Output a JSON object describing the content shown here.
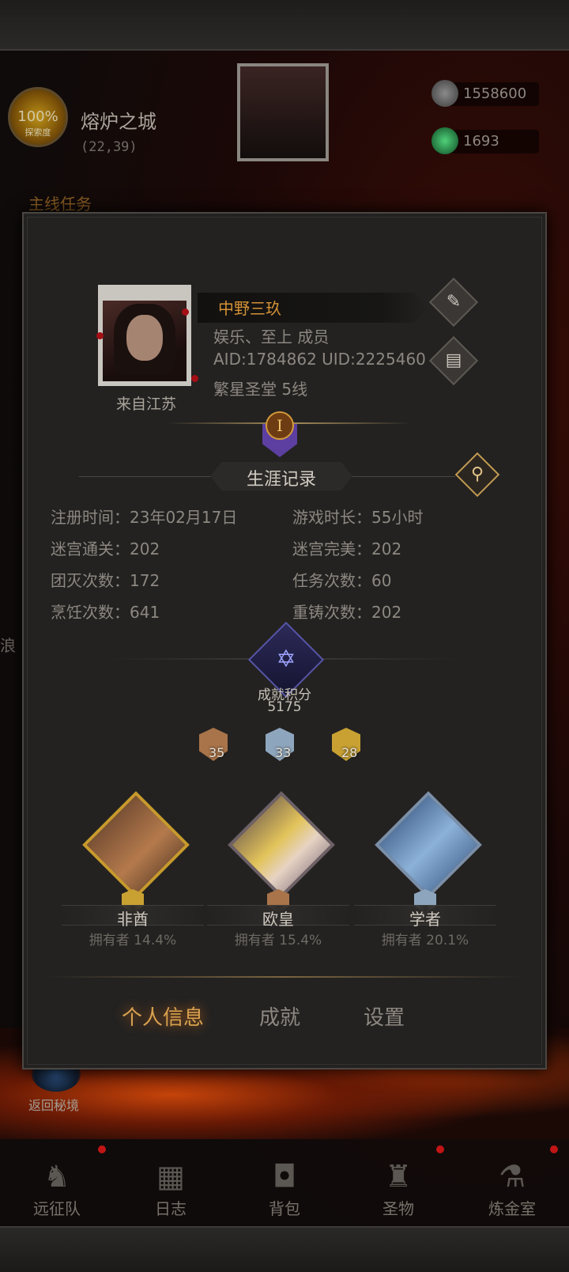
{
  "hud": {
    "explore_pct": "100%",
    "explore_label": "探索度",
    "city_name": "熔炉之城",
    "city_coords": "(22,39)",
    "resource_1": "1558600",
    "resource_2": "1693",
    "quest_title": "主线任务",
    "side_text": "浪",
    "return_label": "返回秘境"
  },
  "profile": {
    "name": "中野三玖",
    "guild_line": "娱乐、至上 成员",
    "ids_line": "AID:1784862  UID:2225460",
    "server_line": "繁星圣堂 5线",
    "from": "来自江苏",
    "rank_numeral": "I"
  },
  "career": {
    "title": "生涯记录",
    "stats": [
      {
        "label": "注册时间：",
        "value": "23年02月17日"
      },
      {
        "label": "游戏时长：",
        "value": "55小时"
      },
      {
        "label": "迷宫通关：",
        "value": "202"
      },
      {
        "label": "迷宫完美：",
        "value": "202"
      },
      {
        "label": "团灭次数：",
        "value": "172"
      },
      {
        "label": "任务次数：",
        "value": "60"
      },
      {
        "label": "烹饪次数：",
        "value": "641"
      },
      {
        "label": "重铸次数：",
        "value": "202"
      }
    ]
  },
  "achievement": {
    "label": "成就积分",
    "score": "5175",
    "medals": [
      {
        "count": "35",
        "color": "#a9744a"
      },
      {
        "count": "33",
        "color": "#8ea6bd"
      },
      {
        "count": "28",
        "color": "#c9a132"
      }
    ]
  },
  "titles": [
    {
      "name": "非酋",
      "owners": "拥有者 14.4%",
      "frame_color": "#c79a2c"
    },
    {
      "name": "欧皇",
      "owners": "拥有者 15.4%",
      "frame_color": "#6d6167"
    },
    {
      "name": "学者",
      "owners": "拥有者 20.1%",
      "frame_color": "#7b8fa7"
    }
  ],
  "tabs": [
    "个人信息",
    "成就",
    "设置"
  ],
  "nav": [
    "远征队",
    "日志",
    "背包",
    "圣物",
    "炼金室"
  ]
}
